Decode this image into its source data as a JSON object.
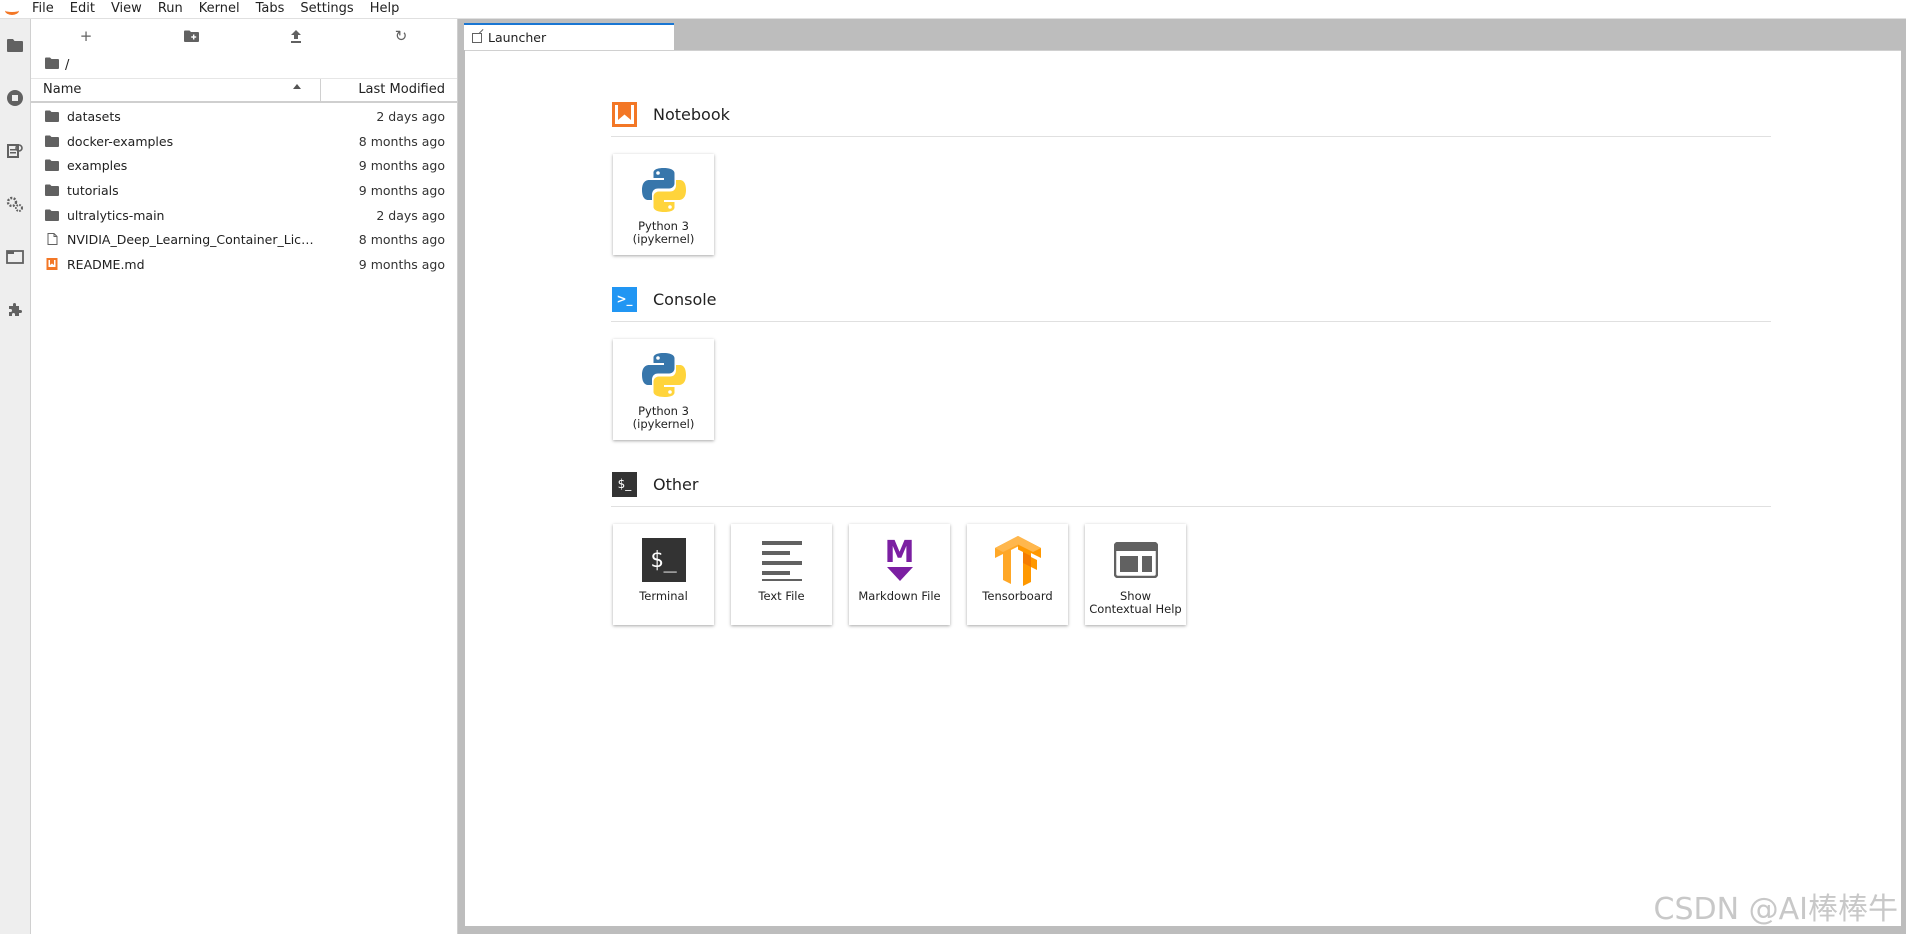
{
  "menubar": {
    "items": [
      "File",
      "Edit",
      "View",
      "Run",
      "Kernel",
      "Tabs",
      "Settings",
      "Help"
    ]
  },
  "activitybar": {
    "icons": [
      "folder-icon",
      "running-icon",
      "commands-icon",
      "property-inspector-icon",
      "tabs-icon",
      "extensions-icon"
    ]
  },
  "filebrowser": {
    "toolbar": {
      "new_launcher": "+",
      "refresh": "↻"
    },
    "breadcrumb": "/",
    "header": {
      "name": "Name",
      "last_modified": "Last Modified"
    },
    "rows": [
      {
        "name": "datasets",
        "modified": "2 days ago",
        "type": "folder"
      },
      {
        "name": "docker-examples",
        "modified": "8 months ago",
        "type": "folder"
      },
      {
        "name": "examples",
        "modified": "9 months ago",
        "type": "folder"
      },
      {
        "name": "tutorials",
        "modified": "9 months ago",
        "type": "folder"
      },
      {
        "name": "ultralytics-main",
        "modified": "2 days ago",
        "type": "folder"
      },
      {
        "name": "NVIDIA_Deep_Learning_Container_License....",
        "modified": "8 months ago",
        "type": "file"
      },
      {
        "name": "README.md",
        "modified": "9 months ago",
        "type": "markdown"
      }
    ]
  },
  "tabs": [
    {
      "label": "Launcher"
    }
  ],
  "launcher": {
    "sections": {
      "notebook": {
        "title": "Notebook",
        "cards": [
          {
            "label": "Python 3 (ipykernel)"
          }
        ]
      },
      "console": {
        "title": "Console",
        "cards": [
          {
            "label": "Python 3 (ipykernel)"
          }
        ]
      },
      "other": {
        "title": "Other",
        "cards": [
          {
            "label": "Terminal"
          },
          {
            "label": "Text File"
          },
          {
            "label": "Markdown File"
          },
          {
            "label": "Tensorboard"
          },
          {
            "label": "Show Contextual Help"
          }
        ]
      }
    },
    "icon_text": {
      "terminal": "$_",
      "markdown": "M",
      "console_glyph": ">_",
      "other_glyph": "$_"
    }
  },
  "colors": {
    "accent_blue": "#1976d2",
    "notebook_orange": "#f37726",
    "console_blue": "#2196f3",
    "markdown_purple": "#7b1fa2",
    "tensorboard_orange": "#ff9800",
    "python_blue": "#3776ab",
    "python_yellow": "#ffd43b"
  },
  "watermark": "CSDN @AI棒棒牛"
}
